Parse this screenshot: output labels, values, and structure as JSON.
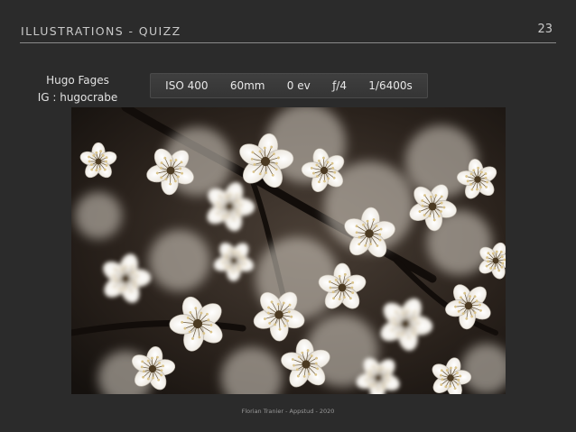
{
  "header": {
    "title": "ILLUSTRATIONS - QUIZZ",
    "page_number": "23"
  },
  "credit": {
    "name": "Hugo Fages",
    "instagram": "IG : hugocrabe"
  },
  "exif": {
    "iso": "ISO 400",
    "focal_length": "60mm",
    "exposure_comp": "0 ev",
    "aperture": "ƒ/4",
    "shutter": "1/6400s"
  },
  "photo": {
    "subject": "white-blossom-photo",
    "colors": {
      "background": "#1c1612",
      "petal": "#f2efe9",
      "petal_shadow": "#bdb6aa",
      "stamen": "#d9c38a",
      "center": "#4b3a22"
    }
  },
  "footer": {
    "text": "Florian Tranier - Appstud - 2020"
  }
}
